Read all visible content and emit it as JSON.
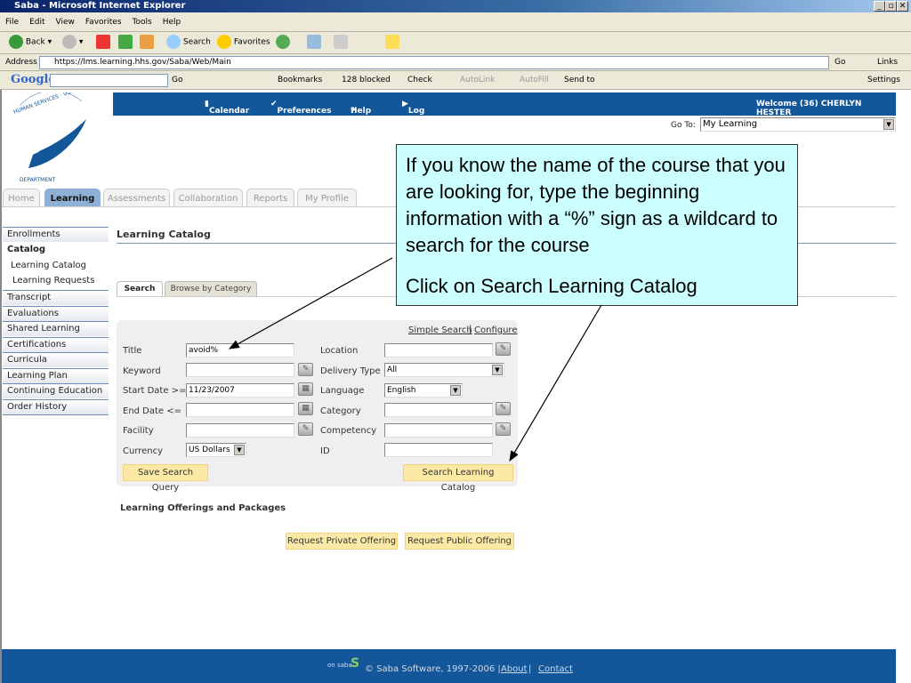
{
  "window": {
    "title": "Saba - Microsoft Internet Explorer"
  },
  "menu": [
    "File",
    "Edit",
    "View",
    "Favorites",
    "Tools",
    "Help"
  ],
  "toolbar": {
    "back": "Back",
    "search": "Search",
    "favorites": "Favorites"
  },
  "address": {
    "label": "Address",
    "url": "https://lms.learning.hhs.gov/Saba/Web/Main",
    "go": "Go",
    "links": "Links"
  },
  "google": {
    "logo": "Google",
    "go": "Go",
    "bookmarks": "Bookmarks",
    "blocked": "128 blocked",
    "check": "Check",
    "autolink": "AutoLink",
    "autofill": "AutoFill",
    "sendto": "Send to",
    "settings": "Settings"
  },
  "header": {
    "calendar": "Calendar",
    "preferences": "Preferences",
    "help": "Help",
    "logout": "Log Out",
    "welcome": "Welcome (36)  CHERLYN HESTER",
    "goto_label": "Go To:",
    "goto_value": "My Learning"
  },
  "logo_text": "DEPARTMENT OF HEALTH & HUMAN SERVICES · USA",
  "tabs": [
    "Home",
    "Learning",
    "Assessments",
    "Collaboration",
    "Reports",
    "My Profile"
  ],
  "sidebar": [
    "Enrollments",
    "Catalog",
    "Learning Catalog",
    "Learning Requests",
    "Transcript",
    "Evaluations",
    "Shared Learning",
    "Certifications",
    "Curricula",
    "Learning Plan",
    "Continuing Education",
    "Order History"
  ],
  "main": {
    "heading": "Learning Catalog",
    "search_tabs": [
      "Search",
      "Browse by Category"
    ],
    "simple_search": "Simple Search",
    "configure": "Configure",
    "fields": {
      "title": "Title",
      "title_value": "avoid%",
      "keyword": "Keyword",
      "start": "Start Date >=",
      "start_value": "11/23/2007",
      "end": "End Date <=",
      "facility": "Facility",
      "currency": "Currency",
      "currency_value": "US Dollars",
      "location": "Location",
      "delivery": "Delivery Type",
      "delivery_value": "All",
      "language": "Language",
      "language_value": "English",
      "category": "Category",
      "competency": "Competency",
      "id": "ID"
    },
    "save_query": "Save Search Query",
    "search_catalog": "Search Learning Catalog",
    "offerings": "Learning Offerings and Packages",
    "req_private": "Request Private Offering",
    "req_public": "Request Public Offering"
  },
  "footer": {
    "brand": "on saba",
    "copyright": "© Saba Software, 1997-2006 |",
    "about": "About",
    "contact": "Contact"
  },
  "callout": {
    "p1": "If you know the name of the course that you are looking for, type the beginning information with a “%” sign as a wildcard to search for the course",
    "p2": "Click on Search Learning Catalog"
  }
}
